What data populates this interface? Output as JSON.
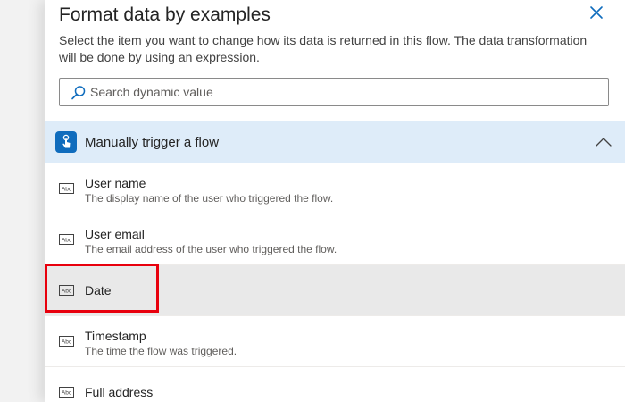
{
  "panel": {
    "title": "Format data by examples",
    "description": "Select the item you want to change how its data is returned in this flow. The data transformation will be done by using an expression.",
    "close_label": "Close"
  },
  "search": {
    "placeholder": "Search dynamic value",
    "value": ""
  },
  "section": {
    "label": "Manually trigger a flow",
    "expanded": true
  },
  "items": [
    {
      "name": "User name",
      "description": "The display name of the user who triggered the flow."
    },
    {
      "name": "User email",
      "description": "The email address of the user who triggered the flow."
    },
    {
      "name": "Date",
      "description": ""
    },
    {
      "name": "Timestamp",
      "description": "The time the flow was triggered."
    },
    {
      "name": "Full address",
      "description": ""
    }
  ],
  "selected_item": "Date",
  "colors": {
    "accent": "#0f6cbd",
    "section_bg": "#deecf9",
    "selected_bg": "#e9e9e9",
    "highlight": "#e8000d"
  },
  "icons": {
    "close": "close-icon",
    "search": "search-icon",
    "trigger": "hand-tap-icon",
    "collapse": "chevron-up-icon",
    "item_type": "abc-text-icon"
  }
}
